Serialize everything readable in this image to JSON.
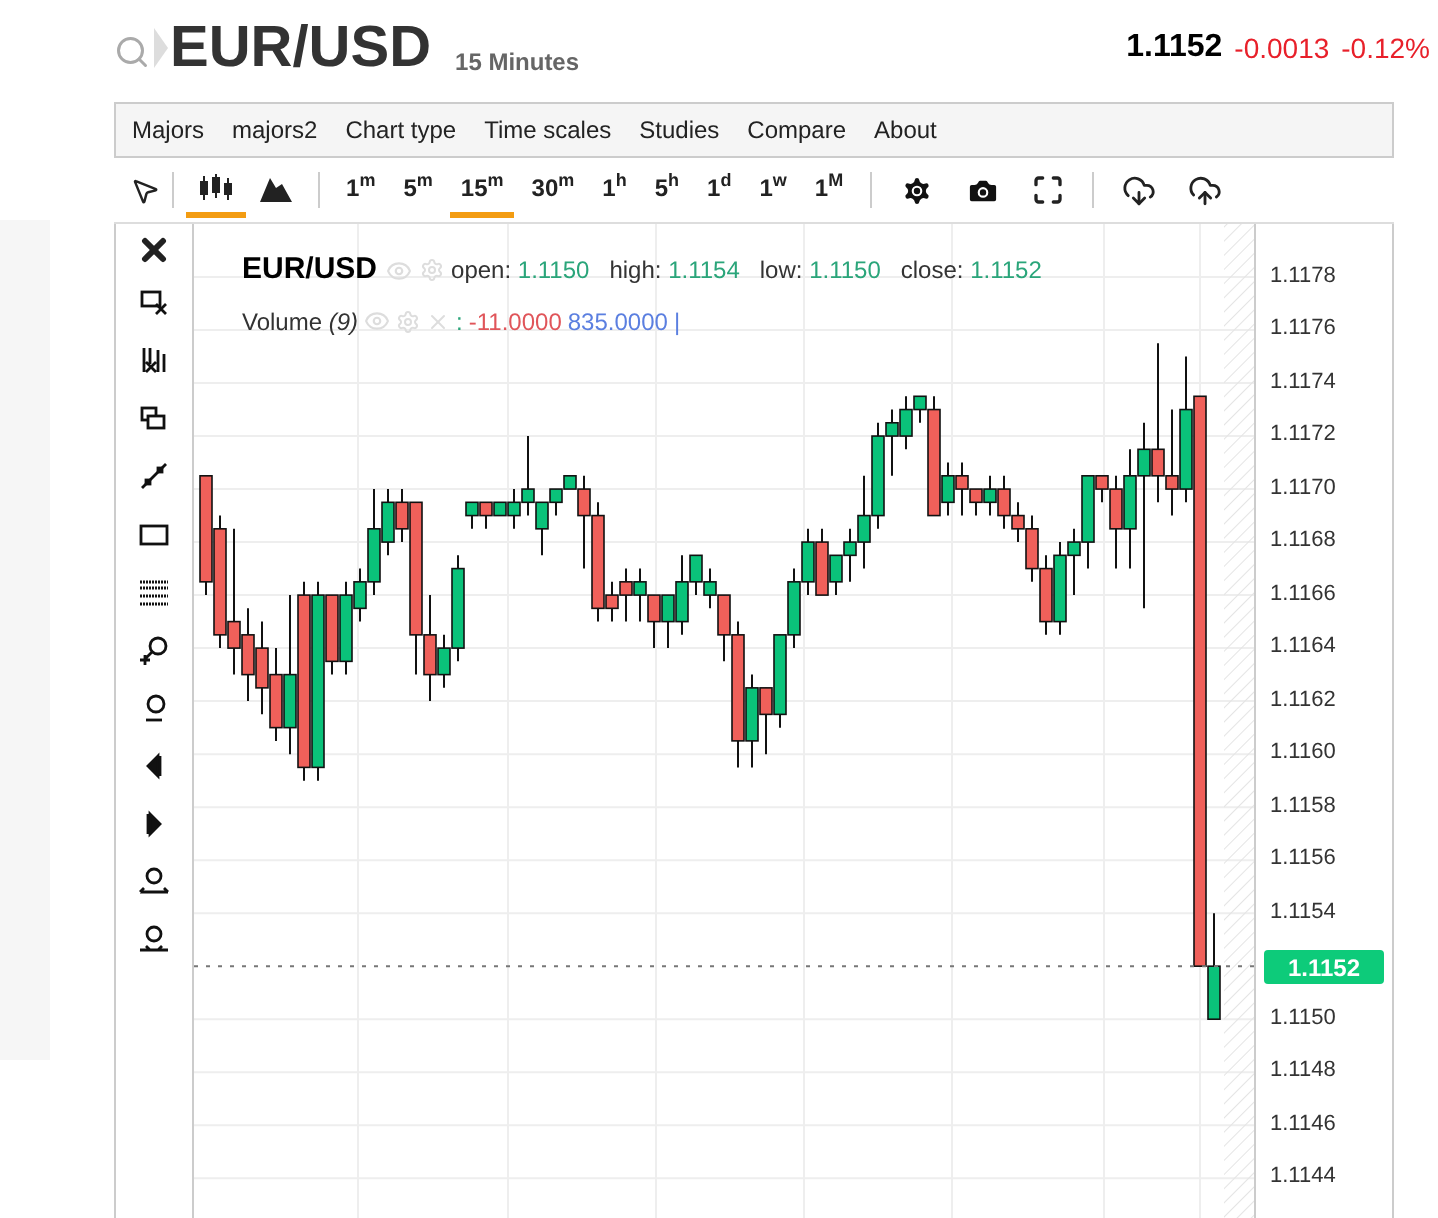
{
  "header": {
    "symbol": "EUR/USD",
    "interval": "15 Minutes",
    "last": "1.1152",
    "change": "-0.0013",
    "change_pct": "-0.12%"
  },
  "menu": [
    "Majors",
    "majors2",
    "Chart type",
    "Time scales",
    "Studies",
    "Compare",
    "About"
  ],
  "chart_types": [
    {
      "kind": "candles",
      "selected": true
    },
    {
      "kind": "mountain",
      "selected": false
    }
  ],
  "timeframes": [
    {
      "label": "1",
      "unit": "m",
      "selected": false
    },
    {
      "label": "5",
      "unit": "m",
      "selected": false
    },
    {
      "label": "15",
      "unit": "m",
      "selected": true
    },
    {
      "label": "30",
      "unit": "m",
      "selected": false
    },
    {
      "label": "1",
      "unit": "h",
      "selected": false
    },
    {
      "label": "5",
      "unit": "h",
      "selected": false
    },
    {
      "label": "1",
      "unit": "d",
      "selected": false
    },
    {
      "label": "1",
      "unit": "w",
      "selected": false
    },
    {
      "label": "1",
      "unit": "M",
      "selected": false
    }
  ],
  "legend": {
    "symbol": "EUR/USD",
    "fields": [
      {
        "label": "open:",
        "value": "1.1150"
      },
      {
        "label": "high:",
        "value": "1.1154"
      },
      {
        "label": "low:",
        "value": "1.1150"
      },
      {
        "label": "close:",
        "value": "1.1152"
      }
    ]
  },
  "volume": {
    "label": "Volume",
    "period": "(9)",
    "separator": ":",
    "values": [
      {
        "text": "-11.0000",
        "color": "#e0555a"
      },
      {
        "text": "835.0000",
        "color": "#5b7fe0"
      }
    ],
    "cursor": "|"
  },
  "chart": {
    "chart_data": {
      "type": "candlestick",
      "grid": true,
      "ref_lines": [
        {
          "axis": "y",
          "value": 1.1152
        }
      ],
      "ohlc": [
        [
          1.11705,
          1.11705,
          1.1166,
          1.11665
        ],
        [
          1.11685,
          1.1169,
          1.1164,
          1.11645
        ],
        [
          1.1165,
          1.11685,
          1.1163,
          1.1164
        ],
        [
          1.11645,
          1.11655,
          1.1162,
          1.1163
        ],
        [
          1.1164,
          1.1165,
          1.11615,
          1.11625
        ],
        [
          1.1163,
          1.1164,
          1.11605,
          1.1161
        ],
        [
          1.1161,
          1.1166,
          1.116,
          1.1163
        ],
        [
          1.1166,
          1.11665,
          1.1159,
          1.11595
        ],
        [
          1.11595,
          1.11665,
          1.1159,
          1.1166
        ],
        [
          1.1166,
          1.1166,
          1.1163,
          1.11635
        ],
        [
          1.11635,
          1.11665,
          1.1163,
          1.1166
        ],
        [
          1.11655,
          1.1167,
          1.1165,
          1.11665
        ],
        [
          1.11665,
          1.117,
          1.1166,
          1.11685
        ],
        [
          1.1168,
          1.117,
          1.11675,
          1.11695
        ],
        [
          1.11695,
          1.117,
          1.1168,
          1.11685
        ],
        [
          1.11695,
          1.11695,
          1.1163,
          1.11645
        ],
        [
          1.11645,
          1.1166,
          1.1162,
          1.1163
        ],
        [
          1.1163,
          1.11645,
          1.11625,
          1.1164
        ],
        [
          1.1164,
          1.11675,
          1.11635,
          1.1167
        ],
        [
          1.1169,
          1.11695,
          1.11685,
          1.11695
        ],
        [
          1.11695,
          1.11695,
          1.11685,
          1.1169
        ],
        [
          1.1169,
          1.11695,
          1.1169,
          1.11695
        ],
        [
          1.1169,
          1.117,
          1.11685,
          1.11695
        ],
        [
          1.11695,
          1.1172,
          1.1169,
          1.117
        ],
        [
          1.11685,
          1.11695,
          1.11675,
          1.11695
        ],
        [
          1.11695,
          1.117,
          1.1169,
          1.117
        ],
        [
          1.117,
          1.11705,
          1.117,
          1.11705
        ],
        [
          1.117,
          1.11705,
          1.1167,
          1.1169
        ],
        [
          1.1169,
          1.11695,
          1.1165,
          1.11655
        ],
        [
          1.1166,
          1.11665,
          1.1165,
          1.11655
        ],
        [
          1.11665,
          1.1167,
          1.1165,
          1.1166
        ],
        [
          1.1166,
          1.1167,
          1.1165,
          1.11665
        ],
        [
          1.1166,
          1.1166,
          1.1164,
          1.1165
        ],
        [
          1.1165,
          1.1166,
          1.1164,
          1.1166
        ],
        [
          1.1165,
          1.11675,
          1.11645,
          1.11665
        ],
        [
          1.11665,
          1.11675,
          1.1166,
          1.11675
        ],
        [
          1.1166,
          1.1167,
          1.11655,
          1.11665
        ],
        [
          1.1166,
          1.1166,
          1.11635,
          1.11645
        ],
        [
          1.11645,
          1.1165,
          1.11595,
          1.11605
        ],
        [
          1.11605,
          1.1163,
          1.11595,
          1.11625
        ],
        [
          1.11625,
          1.11625,
          1.116,
          1.11615
        ],
        [
          1.11615,
          1.11645,
          1.1161,
          1.11645
        ],
        [
          1.11645,
          1.1167,
          1.1164,
          1.11665
        ],
        [
          1.11665,
          1.11685,
          1.1166,
          1.1168
        ],
        [
          1.1168,
          1.11685,
          1.1166,
          1.1166
        ],
        [
          1.11665,
          1.11675,
          1.1166,
          1.11675
        ],
        [
          1.11675,
          1.11685,
          1.11665,
          1.1168
        ],
        [
          1.1168,
          1.11705,
          1.1167,
          1.1169
        ],
        [
          1.1169,
          1.11725,
          1.11685,
          1.1172
        ],
        [
          1.1172,
          1.1173,
          1.11705,
          1.11725
        ],
        [
          1.1172,
          1.11735,
          1.11715,
          1.1173
        ],
        [
          1.1173,
          1.11735,
          1.11725,
          1.11735
        ],
        [
          1.1173,
          1.11735,
          1.1169,
          1.1169
        ],
        [
          1.11695,
          1.1171,
          1.1169,
          1.11705
        ],
        [
          1.11705,
          1.1171,
          1.1169,
          1.117
        ],
        [
          1.117,
          1.117,
          1.1169,
          1.11695
        ],
        [
          1.11695,
          1.11705,
          1.1169,
          1.117
        ],
        [
          1.117,
          1.11705,
          1.11685,
          1.1169
        ],
        [
          1.1169,
          1.11695,
          1.1168,
          1.11685
        ],
        [
          1.11685,
          1.1169,
          1.11665,
          1.1167
        ],
        [
          1.1167,
          1.11675,
          1.11645,
          1.1165
        ],
        [
          1.1165,
          1.1168,
          1.11645,
          1.11675
        ],
        [
          1.11675,
          1.11685,
          1.1166,
          1.1168
        ],
        [
          1.1168,
          1.11705,
          1.1167,
          1.11705
        ],
        [
          1.11705,
          1.11705,
          1.11695,
          1.117
        ],
        [
          1.117,
          1.11705,
          1.1167,
          1.11685
        ],
        [
          1.11685,
          1.11715,
          1.1167,
          1.11705
        ],
        [
          1.11705,
          1.11725,
          1.11655,
          1.11715
        ],
        [
          1.11715,
          1.11755,
          1.11695,
          1.11705
        ],
        [
          1.11705,
          1.1173,
          1.1169,
          1.117
        ],
        [
          1.117,
          1.1175,
          1.11695,
          1.1173
        ],
        [
          1.11735,
          1.11735,
          1.1152,
          1.1152
        ],
        [
          1.115,
          1.1154,
          1.115,
          1.1152
        ]
      ],
      "ylim": [
        1.11425,
        1.118
      ],
      "yticks": [
        {
          "value": 1.1178,
          "label": "1.1178"
        },
        {
          "value": 1.1176,
          "label": "1.1176"
        },
        {
          "value": 1.1174,
          "label": "1.1174"
        },
        {
          "value": 1.1172,
          "label": "1.1172"
        },
        {
          "value": 1.117,
          "label": "1.1170"
        },
        {
          "value": 1.1168,
          "label": "1.1168"
        },
        {
          "value": 1.1166,
          "label": "1.1166"
        },
        {
          "value": 1.1164,
          "label": "1.1164"
        },
        {
          "value": 1.1162,
          "label": "1.1162"
        },
        {
          "value": 1.116,
          "label": "1.1160"
        },
        {
          "value": 1.1158,
          "label": "1.1158"
        },
        {
          "value": 1.1156,
          "label": "1.1156"
        },
        {
          "value": 1.1154,
          "label": "1.1154"
        },
        {
          "value": 1.115,
          "label": "1.1150"
        },
        {
          "value": 1.1148,
          "label": "1.1148"
        },
        {
          "value": 1.1146,
          "label": "1.1146"
        },
        {
          "value": 1.1144,
          "label": "1.1144"
        }
      ]
    }
  },
  "current_price": "1.1152"
}
